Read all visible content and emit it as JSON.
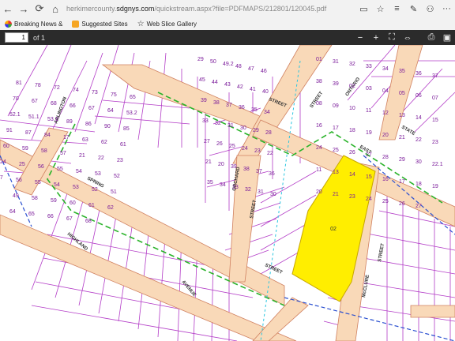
{
  "browser": {
    "url_prefix": "herkimercounty.",
    "url_host": "sdgnys.com",
    "url_rest": "/quickstream.aspx?file=PDFMAPS/212801/120045.pdf",
    "favorites": [
      "Breaking News &",
      "Suggested Sites",
      "Web Slice Gallery"
    ]
  },
  "pdf": {
    "page": "1",
    "of_label": "of 1"
  },
  "map": {
    "streets": [
      "ARLINGTON",
      "SPRING",
      "HIGHLAND",
      "AVENUE",
      "STREET",
      "ORCHARD",
      "STREET",
      "EAST",
      "STATE",
      "STREET",
      "McCLURE",
      "ONTARIO",
      "STREET",
      "STREET"
    ],
    "parcels_left": [
      "81",
      "78",
      "72",
      "74",
      "73",
      "75",
      "65",
      "70",
      "67",
      "68",
      "66",
      "67",
      "64",
      "53.2",
      "52.1",
      "51.1",
      "53.1",
      "89",
      "86",
      "90",
      "85",
      "91",
      "87",
      "84",
      "17",
      "63",
      "62",
      "61",
      "60",
      "59",
      "58",
      "57",
      "21",
      "22",
      "23",
      "24",
      "25",
      "56",
      "55",
      "54",
      "53",
      "52",
      "57",
      "56",
      "55",
      "54",
      "53",
      "52",
      "51",
      "50",
      "49",
      "58",
      "59",
      "60",
      "61",
      "62",
      "63",
      "64",
      "65",
      "66",
      "67",
      "68"
    ],
    "parcels_mid": [
      "29",
      "50",
      "49.2",
      "48",
      "47",
      "46",
      "45",
      "44",
      "43",
      "42",
      "41",
      "40",
      "39",
      "38",
      "37",
      "36",
      "35",
      "34",
      "33",
      "32",
      "31",
      "30",
      "29",
      "28",
      "27",
      "26",
      "25",
      "24",
      "23",
      "22",
      "21",
      "20",
      "39",
      "38",
      "37",
      "36",
      "35",
      "34",
      "33",
      "32",
      "31",
      "30"
    ],
    "parcels_right": [
      "01",
      "31",
      "32",
      "33",
      "34",
      "35",
      "36",
      "37",
      "38",
      "39",
      "02",
      "03",
      "04",
      "05",
      "06",
      "07",
      "08",
      "09",
      "10",
      "11",
      "12",
      "13",
      "14",
      "15",
      "16",
      "17",
      "18",
      "19",
      "20",
      "21",
      "22",
      "23",
      "24",
      "25",
      "26",
      "27",
      "28",
      "29",
      "30",
      "22.1",
      "11",
      "13",
      "14",
      "15",
      "16",
      "17",
      "18",
      "19",
      "20",
      "21",
      "23",
      "24",
      "25",
      "26",
      "27"
    ],
    "highlighted_parcel": "02",
    "highlight_color": "#ffee00"
  }
}
